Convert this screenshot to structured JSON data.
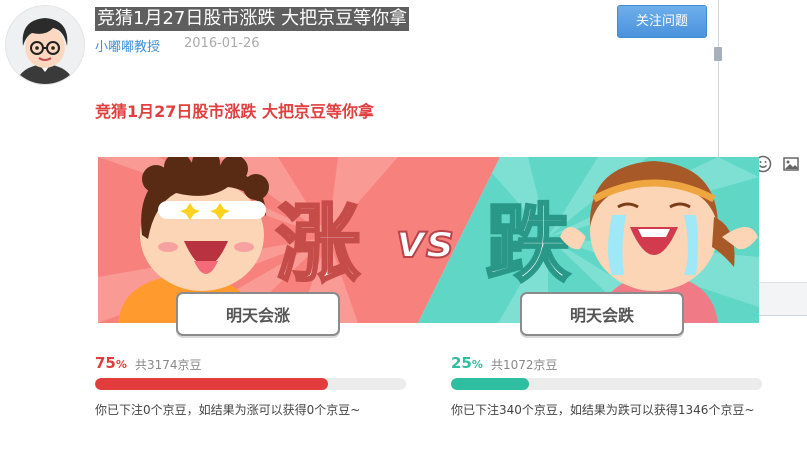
{
  "post": {
    "title": "竞猜1月27日股市涨跌 大把京豆等你拿",
    "author": "小嘟嘟教授",
    "date": "2016-01-26",
    "follow_label": "关注问题",
    "subtitle": "竞猜1月27日股市涨跌 大把京豆等你拿"
  },
  "banner": {
    "left_char": "涨",
    "vs": "vs",
    "right_char": "跌",
    "colors": {
      "left_bg": "#f7817c",
      "right_bg": "#5fd6c6"
    }
  },
  "vote": {
    "up": {
      "button": "明天会涨",
      "percent_value": "75",
      "percent_sign": "%",
      "total": "共3174京豆",
      "note": "你已下注0个京豆，如结果为涨可以获得0个京豆~",
      "ratio": 0.75,
      "color": "#e33c3c"
    },
    "down": {
      "button": "明天会跌",
      "percent_value": "25",
      "percent_sign": "%",
      "total": "共1072京豆",
      "note": "你已下注340个京豆，如结果为跌可以获得1346个京豆~",
      "ratio": 0.25,
      "color": "#2dbf9f"
    }
  },
  "side_panel": {
    "tools": [
      "text-format-icon",
      "emoji-icon",
      "image-icon"
    ]
  }
}
